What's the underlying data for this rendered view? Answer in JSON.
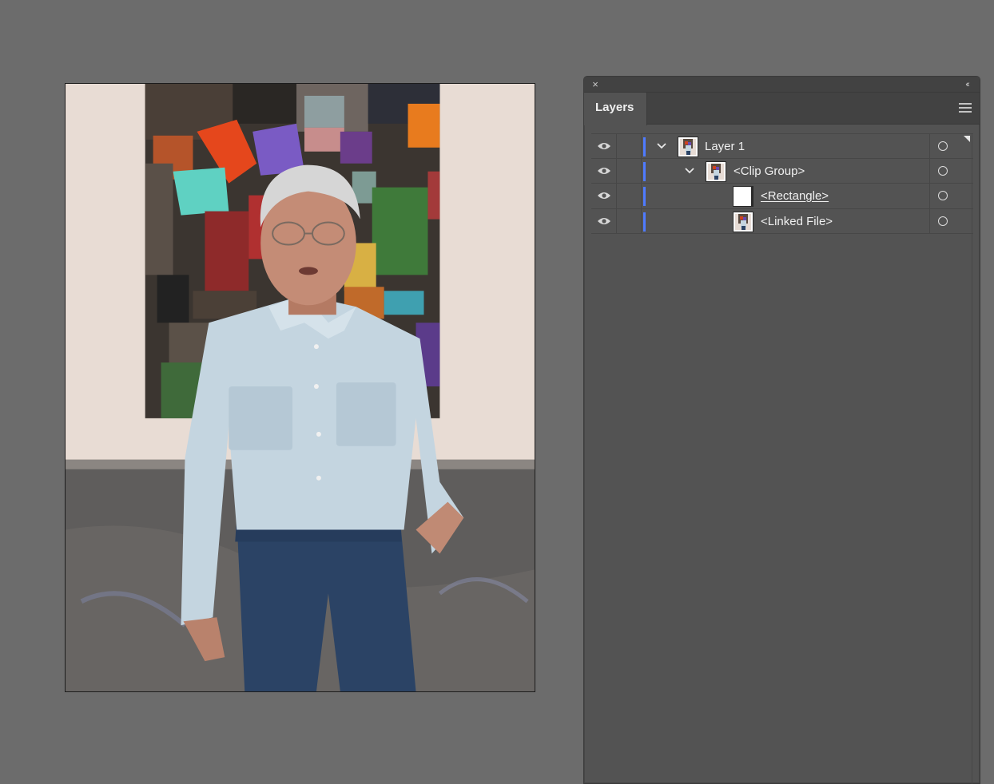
{
  "artboard": {
    "image_description_icon": "placed-photo"
  },
  "panel": {
    "close_icon": "×",
    "collapse_icon": "‹‹",
    "tab_label": "Layers",
    "menu_icon": "hamburger-menu-icon",
    "layers": [
      {
        "name": "Layer 1",
        "expanded": true,
        "thumbnail": "photo",
        "visible": true,
        "style": "normal"
      },
      {
        "name": "<Clip Group>",
        "expanded": true,
        "thumbnail": "photo",
        "visible": true,
        "style": "normal"
      },
      {
        "name": "<Rectangle>",
        "expanded": false,
        "thumbnail": "blank",
        "visible": true,
        "style": "underlined"
      },
      {
        "name": "<Linked File>",
        "expanded": false,
        "thumbnail": "photo",
        "visible": true,
        "style": "normal"
      }
    ],
    "accent_color": "#4f7bff"
  }
}
